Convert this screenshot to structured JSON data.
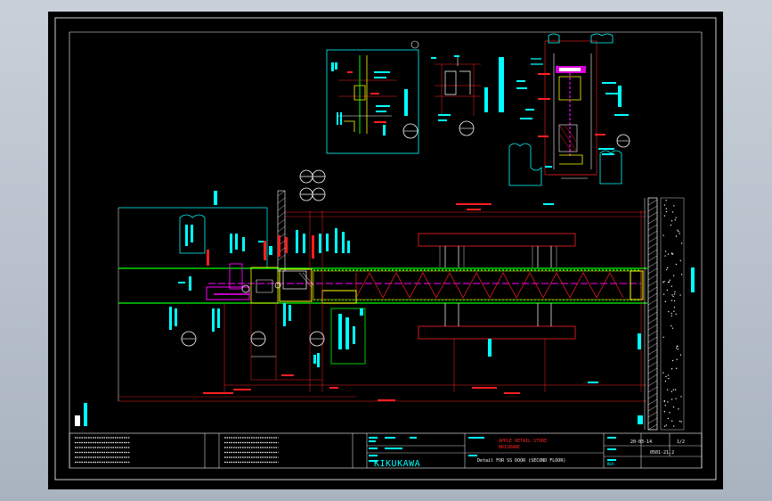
{
  "drawing": {
    "company": "KIKUKAWA",
    "project_lines": [
      "APPLE RETAIL STORE",
      "BRISBANE"
    ],
    "title": "Detail FOR SS DOOR (SECOND FLOOR)",
    "date": "20-03-14",
    "sheet": "1/2",
    "number": "0501-21.2",
    "rev_label": "REV."
  },
  "colors": {
    "background": "#000000",
    "border": "#ffffff",
    "dimension": "#ff2020",
    "annotation": "#00ffff",
    "floor_line": "#00ff00",
    "glass": "#ff00ff",
    "frame": "#ffff00",
    "steel": "#ffffff"
  },
  "icons": [
    "section-marker-icon",
    "grid-bubble-icon",
    "north-arrow-icon"
  ]
}
